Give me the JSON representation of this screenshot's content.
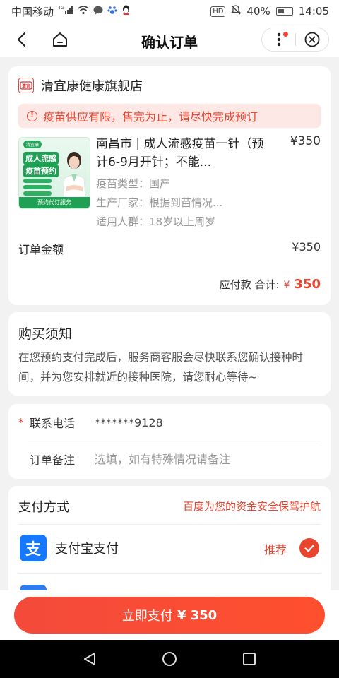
{
  "status_bar": {
    "carrier": "中国移动",
    "network": "4G",
    "time": "14:05",
    "battery": "40%",
    "hd": "HD"
  },
  "nav": {
    "title": "确认订单"
  },
  "store": {
    "name": "清宜康健康旗舰店",
    "logo_text": "清宜康"
  },
  "notice": {
    "text": "疫苗供应有限，售完为止，请尽快完成预订"
  },
  "product": {
    "name": "南昌市 | 成人流感疫苗一针（预计6-9月开针；不能...",
    "price": "¥350",
    "image": {
      "brand": "清宜康",
      "title_line1": "成人流感",
      "title_line2": "疫苗预约",
      "footer": "预约代订服务"
    },
    "attributes": [
      "疫苗类型：国产",
      "生产厂家：根据到苗情况...",
      "适用人群：18岁以上周岁"
    ]
  },
  "order": {
    "amount_label": "订单金额",
    "amount_value": "¥350",
    "due_label": "应付款 合计:",
    "due_symbol": "¥",
    "due_value": "350"
  },
  "purchase_notes": {
    "title": "购买须知",
    "body": "在您预约支付完成后，服务商客服会尽快联系您确认接种时间，并为您安排就近的接种医院，请您耐心等待~"
  },
  "form": {
    "phone_label": "联系电话",
    "phone_value": "*******9128",
    "remark_label": "订单备注",
    "remark_placeholder": "选填，如有特殊情况请备注"
  },
  "payment": {
    "title": "支付方式",
    "safety_text": "百度为您的资金安全保驾护航",
    "method_name": "支付宝支付",
    "recommend": "推荐",
    "alipay_glyph": "支"
  },
  "action": {
    "pay_label": "立即支付",
    "pay_amount": "¥ 350"
  },
  "colors": {
    "accent": "#e8452f",
    "alipay": "#1677ff",
    "notice_bg": "#fde8e6",
    "product_green": "#1ea154"
  }
}
